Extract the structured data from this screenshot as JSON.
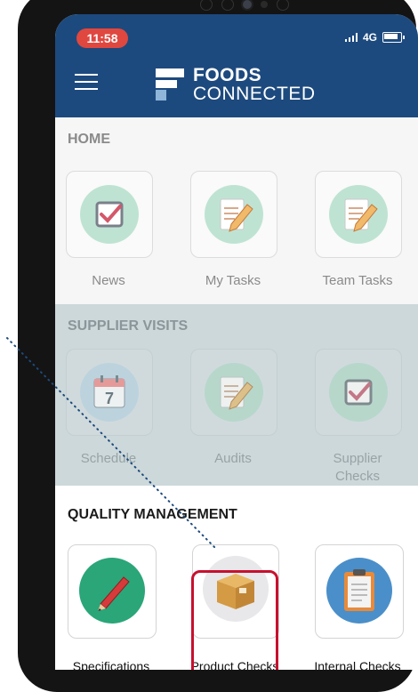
{
  "status": {
    "time": "11:58",
    "network": "4G"
  },
  "brand": {
    "line1": "FOODS",
    "line2": "CONNECTED"
  },
  "sections": {
    "home": {
      "title": "HOME",
      "items": [
        {
          "label": "News"
        },
        {
          "label": "My Tasks"
        },
        {
          "label": "Team Tasks"
        }
      ]
    },
    "supplier_visits": {
      "title": "SUPPLIER VISITS",
      "items": [
        {
          "label": "Schedule"
        },
        {
          "label": "Audits"
        },
        {
          "label": "Supplier Checks"
        }
      ]
    },
    "quality": {
      "title": "QUALITY MANAGEMENT",
      "items": [
        {
          "label": "Specifications"
        },
        {
          "label": "Product Checks"
        },
        {
          "label": "Internal Checks"
        }
      ]
    }
  },
  "calendar_day": "7",
  "colors": {
    "header": "#1d4a7e",
    "badge": "#e0473f",
    "highlight": "#c8102e",
    "teal": "#5ec4a4"
  }
}
